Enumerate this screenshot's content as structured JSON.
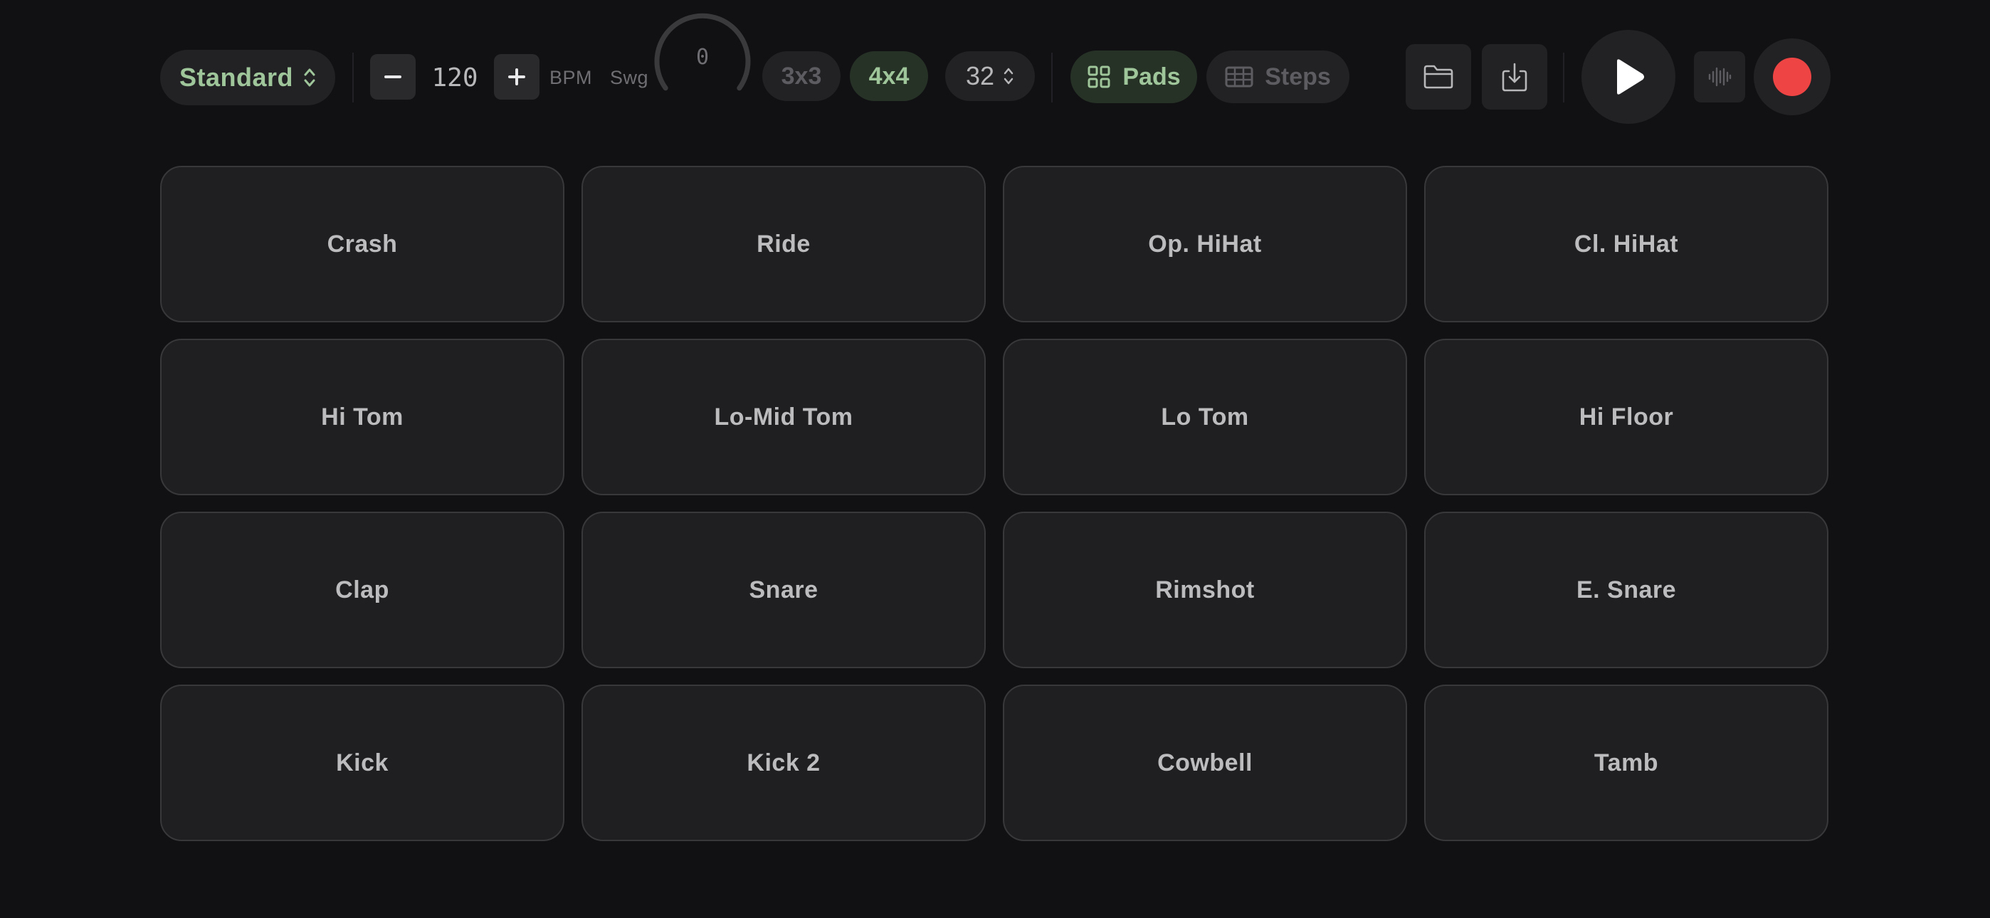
{
  "toolbar": {
    "kit_label": "Standard",
    "bpm_decrement_label": "−",
    "bpm_value": "120",
    "bpm_increment_label": "+",
    "bpm_unit": "BPM",
    "swing_label": "Swg",
    "swing_value": "0",
    "grid_options": [
      {
        "label": "3x3",
        "selected": false
      },
      {
        "label": "4x4",
        "selected": true
      }
    ],
    "steps_value": "32",
    "view_modes": [
      {
        "label": "Pads",
        "icon": "grid-icon",
        "selected": true
      },
      {
        "label": "Steps",
        "icon": "table-icon",
        "selected": false
      }
    ],
    "icons": {
      "kit_select": "chevron-up-down-icon",
      "open": "folder-icon",
      "save": "download-icon",
      "play": "play-icon",
      "waveform": "waveform-icon",
      "record": "record-icon"
    }
  },
  "pads": [
    {
      "label": "Crash"
    },
    {
      "label": "Ride"
    },
    {
      "label": "Op. HiHat"
    },
    {
      "label": "Cl. HiHat"
    },
    {
      "label": "Hi Tom"
    },
    {
      "label": "Lo-Mid Tom"
    },
    {
      "label": "Lo Tom"
    },
    {
      "label": "Hi Floor"
    },
    {
      "label": "Clap"
    },
    {
      "label": "Snare"
    },
    {
      "label": "Rimshot"
    },
    {
      "label": "E. Snare"
    },
    {
      "label": "Kick"
    },
    {
      "label": "Kick 2"
    },
    {
      "label": "Cowbell"
    },
    {
      "label": "Tamb"
    }
  ],
  "colors": {
    "background": "#111113",
    "accent": "#9fc59a",
    "accent_bg": "#273227",
    "record": "#ef4444",
    "pad_bg": "#1f1f21",
    "pad_border": "#38383b"
  }
}
